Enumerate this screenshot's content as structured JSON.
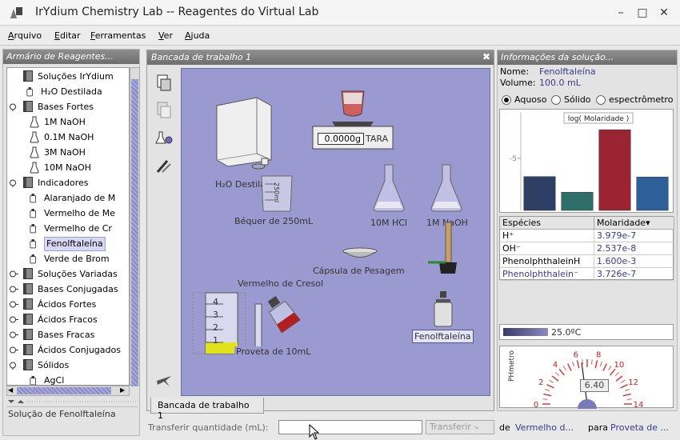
{
  "window": {
    "title": "IrYdium Chemistry Lab -- Reagentes do Virtual Lab",
    "controls": [
      "–",
      "□",
      "✕"
    ]
  },
  "menu": [
    {
      "label": "Arquivo"
    },
    {
      "label": "Editar"
    },
    {
      "label": "Ferramentas"
    },
    {
      "label": "Ver"
    },
    {
      "label": "Ajuda"
    }
  ],
  "left": {
    "header": "Armário de Reagentes...",
    "status": "Solução de Fenolftaleína",
    "tree": [
      {
        "label": "Soluções IrYdium",
        "level": 0,
        "icon": "book-icon"
      },
      {
        "label": "H₂O Destilada",
        "level": 1,
        "icon": "bottle-icon"
      },
      {
        "label": "Bases Fortes",
        "level": 0,
        "icon": "book-icon"
      },
      {
        "label": "1M NaOH",
        "level": 2,
        "icon": "flask-icon"
      },
      {
        "label": "0.1M NaOH",
        "level": 2,
        "icon": "flask-icon"
      },
      {
        "label": "3M NaOH",
        "level": 2,
        "icon": "flask-icon"
      },
      {
        "label": "10M NaOH",
        "level": 2,
        "icon": "flask-icon"
      },
      {
        "label": "Indicadores",
        "level": 0,
        "icon": "book-icon"
      },
      {
        "label": "Alaranjado de M",
        "level": 2,
        "icon": "bottle-icon"
      },
      {
        "label": "Vermelho de Me",
        "level": 2,
        "icon": "bottle-icon"
      },
      {
        "label": "Vermelho de Cr",
        "level": 2,
        "icon": "bottle-icon"
      },
      {
        "label": "Fenolftaleína",
        "level": 2,
        "icon": "bottle-icon",
        "selected": true
      },
      {
        "label": "Verde de Brom",
        "level": 2,
        "icon": "bottle-icon"
      },
      {
        "label": "Soluções Variadas",
        "level": 0,
        "icon": "book-icon"
      },
      {
        "label": "Bases Conjugadas",
        "level": 0,
        "icon": "book-icon"
      },
      {
        "label": "Ácidos Fortes",
        "level": 0,
        "icon": "book-icon"
      },
      {
        "label": "Ácidos Fracos",
        "level": 0,
        "icon": "book-icon"
      },
      {
        "label": "Bases Fracas",
        "level": 0,
        "icon": "book-icon"
      },
      {
        "label": "Ácidos Conjugados",
        "level": 0,
        "icon": "book-icon"
      },
      {
        "label": "Sólidos",
        "level": 0,
        "icon": "book-icon"
      },
      {
        "label": "AgCl",
        "level": 2,
        "icon": "bottle-icon"
      }
    ]
  },
  "bench": {
    "header": "Bancada de trabalho 1",
    "tab": "Bancada de trabalho 1",
    "scale_value": "0.0000g",
    "scale_tare": "TARA",
    "labels": {
      "water": "H₂O Destilada",
      "beaker": "Béquer de 250mL",
      "hcl": "10M HCl",
      "naoh": "1M NaOH",
      "capsule": "Cápsula de Pesagem",
      "cresol": "Vermelho de Cresol",
      "cylinder": "Proveta de 10mL",
      "phenol": "Fenolftaleína",
      "beaker_mark": "250ml"
    },
    "cylinder_marks": [
      "4",
      "3",
      "2",
      "1"
    ]
  },
  "right": {
    "header": "Informações da solução...",
    "name_label": "Nome:",
    "name_value": "Fenolftaleína",
    "volume_label": "Volume:",
    "volume_value": "100.0 mL",
    "radios": [
      {
        "label": "Aquoso",
        "on": true
      },
      {
        "label": "Sólido",
        "on": false
      },
      {
        "label": "espectrômetro",
        "on": false
      }
    ],
    "temperature": "25.0ºC",
    "ph_label": "PHmetro",
    "ph_value": "6.40",
    "ph_ticks": [
      "0",
      "2",
      "4",
      "6",
      "8",
      "10",
      "12",
      "14"
    ]
  },
  "chart_data": {
    "type": "bar",
    "title": "log( Molaridade )",
    "ylabel": "",
    "y_tick_labels": [
      "-5"
    ],
    "ylim": [
      -9,
      -1.5
    ],
    "categories": [
      "H⁺",
      "OH⁻",
      "PhenolphthaleinH",
      "Phenolphthalein⁻"
    ],
    "values": [
      -6.4,
      -7.6,
      -2.8,
      -6.43
    ],
    "colors": [
      "#2e3f66",
      "#2f6f6a",
      "#9a2432",
      "#2d5f99"
    ]
  },
  "species": {
    "headers": [
      "Espécies",
      "Molaridade▾"
    ],
    "rows": [
      {
        "name": "H⁺",
        "value": "3.979e-7",
        "color": "#000000"
      },
      {
        "name": "OH⁻",
        "value": "2.537e-8",
        "color": "#000000"
      },
      {
        "name": "PhenolphthaleinH",
        "value": "1.600e-3",
        "color": "#000000"
      },
      {
        "name": "Phenolphthalein⁻",
        "value": "3.726e-7",
        "color": "#3a3a8a"
      }
    ]
  },
  "bottom": {
    "transfer_label": "Transferir quantidade (mL):",
    "transfer_value": "",
    "transfer_button": "Transferir",
    "de": "de",
    "source": "Vermelho d...",
    "para": "para",
    "target": "Proveta de ..."
  }
}
